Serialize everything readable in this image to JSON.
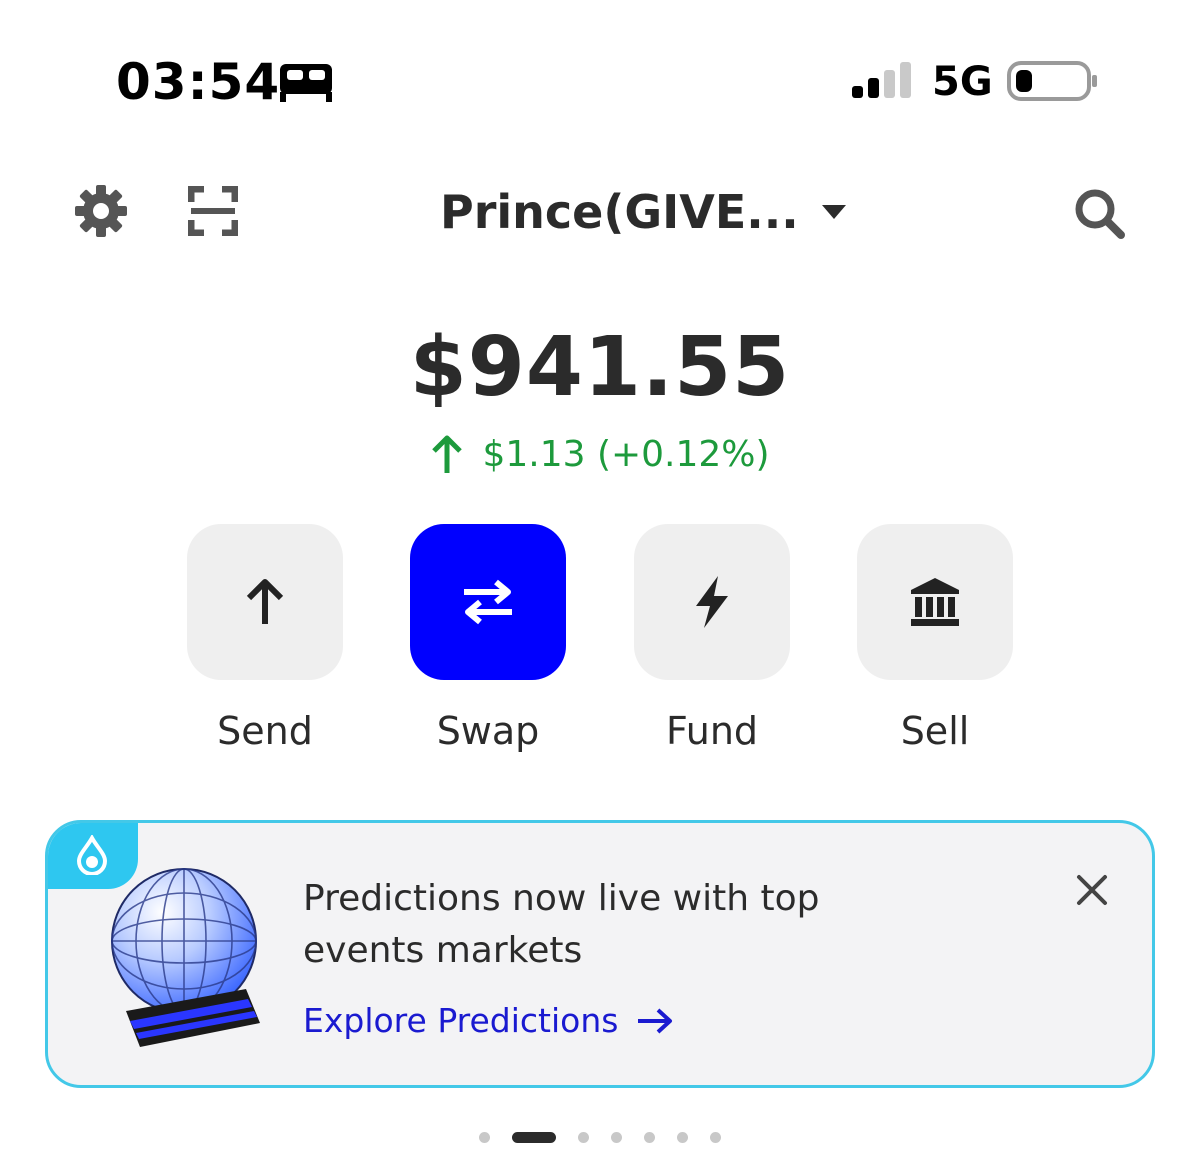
{
  "status_bar": {
    "time": "03:54",
    "sleep_icon": "bed-icon",
    "network": "5G",
    "signal_icon": "signal-bars-icon",
    "battery_icon": "battery-icon"
  },
  "header": {
    "account_name": "Prince(GIVE...",
    "settings_icon": "gear-icon",
    "scan_icon": "scan-icon",
    "search_icon": "search-icon"
  },
  "balance": {
    "amount": "$941.55",
    "change": "$1.13 (+0.12%)",
    "change_color": "#1d9a3c"
  },
  "actions": [
    {
      "label": "Send",
      "icon": "arrow-up-icon"
    },
    {
      "label": "Swap",
      "icon": "swap-icon",
      "primary": true,
      "color": "#0000ff"
    },
    {
      "label": "Fund",
      "icon": "lightning-icon"
    },
    {
      "label": "Sell",
      "icon": "bank-icon"
    }
  ],
  "promo": {
    "title": "Predictions now live with top events markets",
    "link_label": "Explore Predictions",
    "accent": "#43c8e8",
    "link_color": "#1a1ad0"
  },
  "pager": {
    "count": 7,
    "active_index": 1
  }
}
